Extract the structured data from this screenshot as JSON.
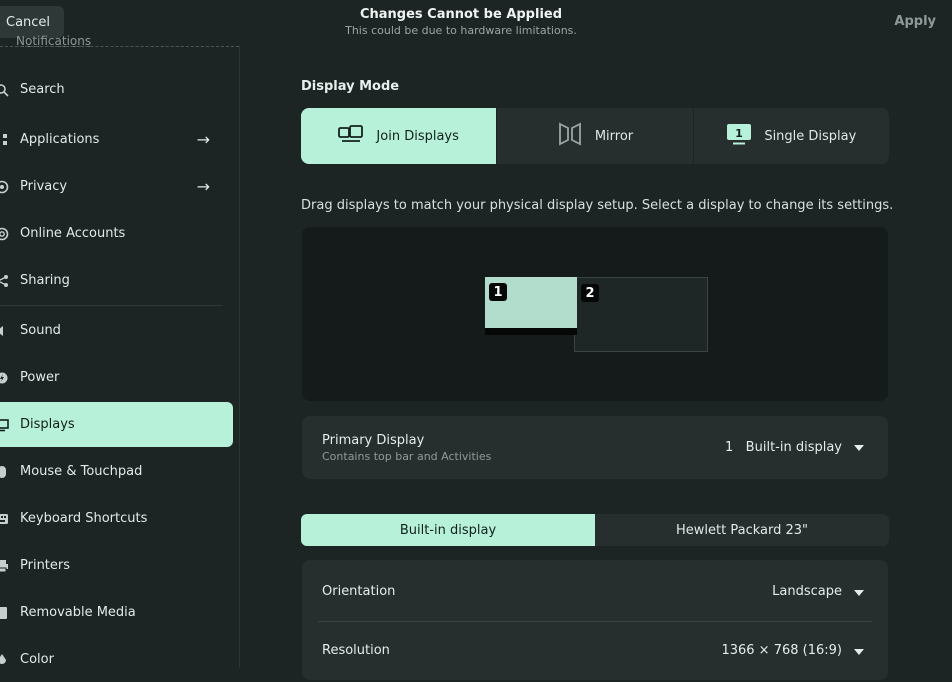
{
  "header": {
    "cancel_label": "Cancel",
    "title": "Changes Cannot be Applied",
    "subtitle": "This could be due to hardware limitations.",
    "apply_label": "Apply"
  },
  "sidebar": {
    "ghost_label": "Notifications",
    "items": [
      {
        "label": "Search",
        "icon": "search-icon"
      },
      {
        "label": "Applications",
        "icon": "grid-icon"
      },
      {
        "label": "Privacy",
        "icon": "hand-icon"
      },
      {
        "label": "Online Accounts",
        "icon": "at-icon"
      },
      {
        "label": "Sharing",
        "icon": "share-icon"
      },
      {
        "label": "Sound",
        "icon": "speaker-icon"
      },
      {
        "label": "Power",
        "icon": "power-icon"
      },
      {
        "label": "Displays",
        "icon": "monitor-icon"
      },
      {
        "label": "Mouse & Touchpad",
        "icon": "mouse-icon"
      },
      {
        "label": "Keyboard Shortcuts",
        "icon": "keyboard-icon"
      },
      {
        "label": "Printers",
        "icon": "printer-icon"
      },
      {
        "label": "Removable Media",
        "icon": "media-icon"
      },
      {
        "label": "Color",
        "icon": "color-icon"
      }
    ],
    "active": "Displays"
  },
  "main": {
    "section_title": "Display Mode",
    "modes": [
      {
        "label": "Join Displays",
        "icon": "join-displays-icon",
        "active": true
      },
      {
        "label": "Mirror",
        "icon": "mirror-icon",
        "active": false
      },
      {
        "label": "Single Display",
        "icon": "single-display-icon",
        "active": false
      }
    ],
    "hint": "Drag displays to match your physical display setup. Select a display to change its settings.",
    "monitor1_label": "1",
    "monitor2_label": "2",
    "primary": {
      "label": "Primary Display",
      "sub": "Contains top bar and Activities",
      "value": "1   Built-in display"
    },
    "tabs": [
      {
        "label": "Built-in display",
        "active": true
      },
      {
        "label": "Hewlett Packard 23\"",
        "active": false
      }
    ],
    "settings": {
      "orientation_label": "Orientation",
      "orientation_value": "Landscape",
      "resolution_label": "Resolution",
      "resolution_value": "1366 × 768 (16:9)"
    }
  },
  "colors": {
    "accent": "#b7f1da",
    "background": "#1d2524",
    "card": "#262f2d"
  }
}
